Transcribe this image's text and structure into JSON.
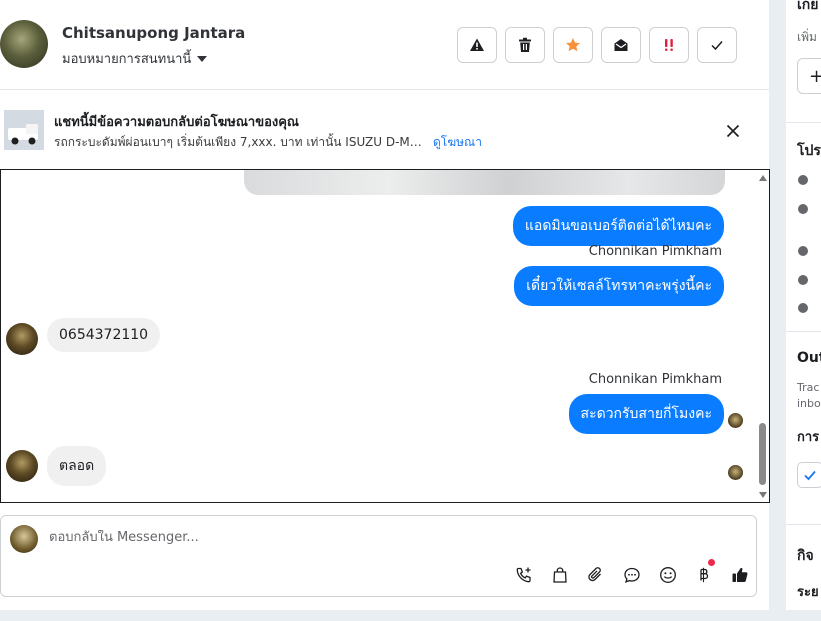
{
  "header": {
    "contact_name": "Chitsanupong Jantara",
    "assign_label": "มอบหมายการสนทนานี้"
  },
  "actions": [
    {
      "name": "spam-button",
      "icon": "warning-icon"
    },
    {
      "name": "delete-button",
      "icon": "trash-icon"
    },
    {
      "name": "follow-up-button",
      "icon": "star-icon",
      "color": "#f7923b"
    },
    {
      "name": "mark-unread-button",
      "icon": "envelope-open-icon"
    },
    {
      "name": "priority-button",
      "icon": "priority-icon",
      "color": "#e41e3f"
    },
    {
      "name": "done-button",
      "icon": "checkmark-icon"
    }
  ],
  "ad": {
    "title": "แชทนี้มีข้อความตอบกลับต่อโฆษณาของคุณ",
    "subtitle": "รถกระบะดัมพ์ผ่อนเบาๆ เริ่มต้นเพียง 7,xxx. บาท เท่านั้น ISUZU D-MAX A...",
    "link": "ดูโฆษณา"
  },
  "messages": {
    "m1": "แอดมินขอเบอร์ติดต่อได้ไหมคะ",
    "sender1": "Chonnikan Pimkham",
    "m2": "เดี๋ยวให้เซลล์โทรหาคะพรุ่งนี้คะ",
    "m3": "0654372110",
    "sender2": "Chonnikan Pimkham",
    "m4": "สะดวกรับสายกี่โมงคะ",
    "m5": "ตลอด"
  },
  "composer": {
    "placeholder": "ตอบกลับใน Messenger..."
  },
  "right_panel": {
    "label_top": "เกย",
    "label_add": "เพิ่ม",
    "add_button": "+",
    "profile_heading": "โปร",
    "out_heading": "Out",
    "track_line1": "Trac",
    "track_line2": "inbo",
    "section_label": "การ",
    "activity_heading": "กิจ",
    "period_label": "ระย"
  },
  "colors": {
    "accent": "#0a7cff",
    "link": "#1877f2",
    "star": "#f7923b",
    "priority": "#e41e3f"
  }
}
